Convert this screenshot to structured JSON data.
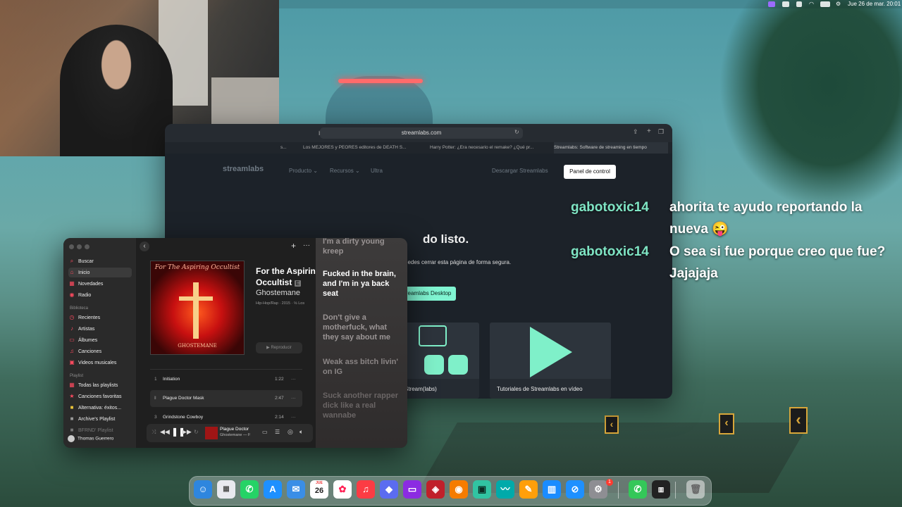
{
  "menubar": {
    "datetime": "Jue 26 de mar.  20:01"
  },
  "browser": {
    "url": "streamlabs.com",
    "tabs": [
      "s...",
      "Los MEJORES y PEORES editores de DEATH S...",
      "Harry Potter: ¿Era necesario el remake? ¿Qué pr...",
      "Streamlabs: Software de streaming en tiempo"
    ],
    "brand": "streamlabs",
    "nav": [
      "Producto ⌄",
      "Recursos ⌄",
      "Ultra",
      "Descargar Streamlabs"
    ],
    "panel_button": "Panel de control",
    "headline": "do listo.",
    "subtext": "uedes cerrar esta página de forma segura.",
    "green_button": "treamlabs Desktop",
    "card1_label": "Stream(labs)",
    "card2_label": "Tutoriales de Streamlabs en vídeo"
  },
  "music": {
    "sidebar": {
      "items": [
        {
          "icon": "⌕",
          "label": "Buscar"
        },
        {
          "icon": "⌂",
          "label": "Inicio"
        },
        {
          "icon": "▦",
          "label": "Novedades"
        },
        {
          "icon": "◉",
          "label": "Radio"
        }
      ],
      "library_header": "Biblioteca",
      "library": [
        {
          "icon": "◷",
          "label": "Recientes"
        },
        {
          "icon": "♪",
          "label": "Artistas"
        },
        {
          "icon": "▭",
          "label": "Álbumes"
        },
        {
          "icon": "♫",
          "label": "Canciones"
        },
        {
          "icon": "▣",
          "label": "Videos musicales"
        }
      ],
      "playlist_header": "Playlist",
      "playlists": [
        {
          "icon": "▦",
          "label": "Todas las playlists"
        },
        {
          "icon": "★",
          "label": "Canciones favoritas"
        },
        {
          "icon": "■",
          "label": "Alternativa: éxitos..."
        },
        {
          "icon": "■",
          "label": "Archive's Playlist"
        },
        {
          "icon": "■",
          "label": "BFRND' Playlist"
        }
      ],
      "user": "Thomas Guerrero"
    },
    "album": {
      "cover_title": "For The Aspiring Occultist",
      "cover_bottom": "GHOSTEMANE",
      "title": "For the Aspirin",
      "title2": "Occultist",
      "artist": "Ghostemane",
      "meta": "Hip-Hop/Rap · 2015 · ℅ Los",
      "play_label": "▶ Reproducir"
    },
    "tracks": [
      {
        "n": "1",
        "title": "Initiation",
        "dur": "1:22"
      },
      {
        "n": "‖",
        "title": "Plague Doctor Mask",
        "dur": "2:47"
      },
      {
        "n": "3",
        "title": "Grindstone Cowboy",
        "dur": "2:14"
      }
    ],
    "lyrics": [
      "I'm a dirty young kreep",
      "Fucked in the brain, and I'm in ya back seat",
      "Don't give a motherfuck, what they say about me",
      "Weak ass bitch livin' on IG",
      "Suck another rapper dick like a real wannabe"
    ],
    "now_playing": {
      "title": "Plague Doctor",
      "artist": "Ghostemane — F"
    }
  },
  "chat": [
    {
      "user": "gabotoxic14",
      "message": "ahorita te ayudo reportando la nueva 😜"
    },
    {
      "user": "gabotoxic14",
      "message": "O sea si fue porque creo que fue? Jajajaja"
    }
  ],
  "dock": {
    "calendar_month": "JUE",
    "calendar_day": "26",
    "badge": "1"
  }
}
